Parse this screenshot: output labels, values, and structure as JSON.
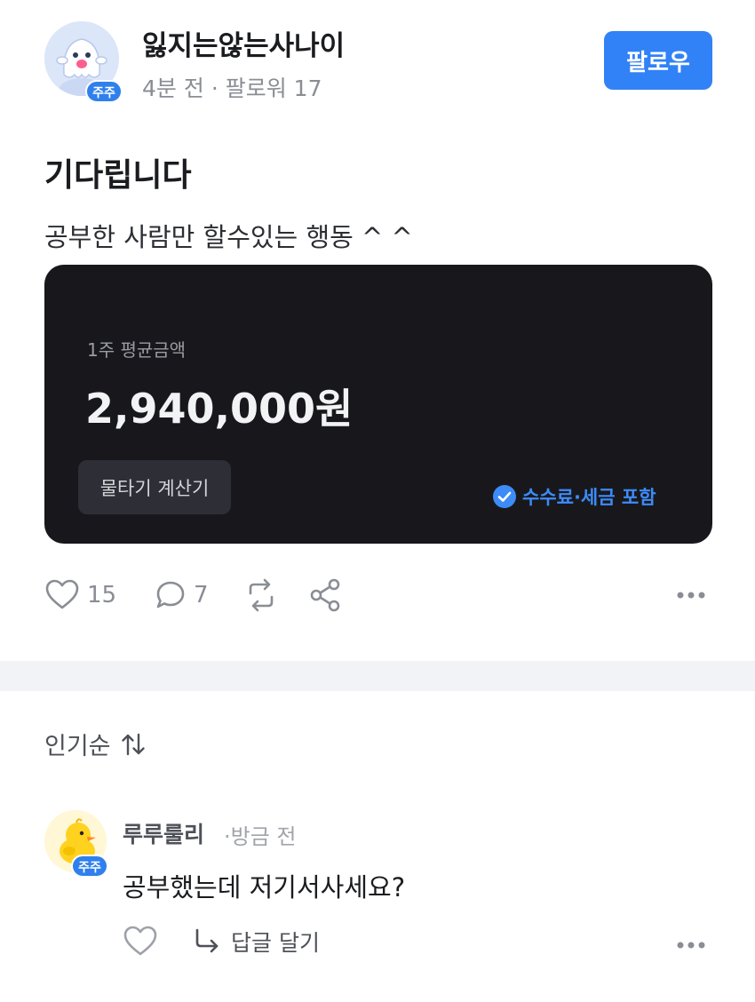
{
  "post": {
    "author": {
      "name": "잃지는않는사나이",
      "badge": "주주",
      "time": "4분 전",
      "separator": "·",
      "followers": "팔로워 17",
      "avatar_icon": "ghost-character-icon"
    },
    "follow_label": "팔로우",
    "title": "기다립니다",
    "body": "공부한 사람만 할수있는 행동  ^ ^",
    "card": {
      "label": "1주 평균금액",
      "amount": "2,940,000원",
      "button_label": "물타기 계산기",
      "note": "수수료·세금 포함",
      "note_icon": "check-circle-icon"
    },
    "actions": {
      "likes": "15",
      "comments": "7",
      "icons": [
        "heart-icon",
        "comment-icon",
        "repost-icon",
        "share-icon",
        "more-icon"
      ]
    }
  },
  "comments_section": {
    "sort_label": "인기순",
    "sort_icon": "sort-arrows-icon",
    "items": [
      {
        "name": "루루룰리",
        "time": "·방금 전",
        "badge": "주주",
        "text": "공부했는데 저기서사세요?",
        "reply_label": "답글 달기",
        "avatar_icon": "duck-icon"
      }
    ]
  },
  "colors": {
    "accent": "#3182f6",
    "card_bg": "#18181c",
    "muted_text": "#8a8d94",
    "divider": "#f2f3f6"
  }
}
